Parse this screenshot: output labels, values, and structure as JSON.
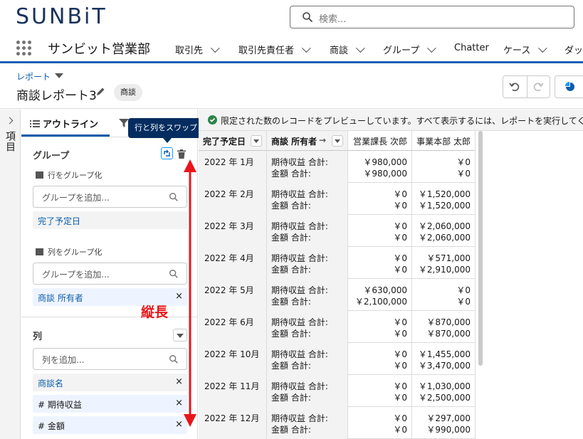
{
  "brand": {
    "logo_text": "SUNBiT"
  },
  "search": {
    "placeholder": "検索..."
  },
  "nav": {
    "app_name": "サンビット営業部",
    "items": [
      {
        "label": "取引先"
      },
      {
        "label": "取引先責任者"
      },
      {
        "label": "商談"
      },
      {
        "label": "グループ"
      },
      {
        "label": "Chatter"
      },
      {
        "label": "ケース"
      },
      {
        "label": "ダッ"
      }
    ]
  },
  "report": {
    "type_label": "レポート",
    "title": "商談レポート3",
    "badge": "商談"
  },
  "left_strip": {
    "label": "項目"
  },
  "outline": {
    "tab_label": "アウトライン",
    "tooltip": "行と列をスワップ",
    "groups_title": "グループ",
    "row_group_label": "行をグループ化",
    "row_group_placeholder": "グループを追加...",
    "row_group_item": "完了予定日",
    "col_group_label": "列をグループ化",
    "col_group_placeholder": "グループを追加...",
    "col_group_item": "商談 所有者",
    "columns_title": "列",
    "columns_placeholder": "列を追加...",
    "columns": [
      {
        "label": "商談名"
      },
      {
        "label": "# 期待収益"
      },
      {
        "label": "# 金額"
      }
    ],
    "remove_glyph": "×"
  },
  "annotation": {
    "text": "縦長",
    "color": "#e8161b"
  },
  "preview": {
    "info": "限定された数のレコードをプレビューしています。すべて表示するには、レポートを実行してくだ",
    "headers": {
      "date": "完了予定日",
      "owner": "商談 所有者",
      "arrow": "→",
      "col1": "営業課長 次郎",
      "col2": "事業本部 太郎"
    },
    "label_expected": "期待収益 合計:",
    "label_amount": "金額 合計:",
    "rows": [
      {
        "date": "2022 年 1月",
        "c1_exp": "￥980,000",
        "c1_amt": "￥980,000",
        "c2_exp": "￥0",
        "c2_amt": "￥0"
      },
      {
        "date": "2022 年 2月",
        "c1_exp": "￥0",
        "c1_amt": "￥0",
        "c2_exp": "￥1,520,000",
        "c2_amt": "￥1,520,000"
      },
      {
        "date": "2022 年 3月",
        "c1_exp": "￥0",
        "c1_amt": "￥0",
        "c2_exp": "￥2,060,000",
        "c2_amt": "￥2,060,000"
      },
      {
        "date": "2022 年 4月",
        "c1_exp": "￥0",
        "c1_amt": "￥0",
        "c2_exp": "￥571,000",
        "c2_amt": "￥2,910,000"
      },
      {
        "date": "2022 年 5月",
        "c1_exp": "￥630,000",
        "c1_amt": "￥2,100,000",
        "c2_exp": "￥0",
        "c2_amt": "￥0"
      },
      {
        "date": "2022 年 6月",
        "c1_exp": "￥0",
        "c1_amt": "￥0",
        "c2_exp": "￥870,000",
        "c2_amt": "￥870,000"
      },
      {
        "date": "2022 年 10月",
        "c1_exp": "￥0",
        "c1_amt": "￥0",
        "c2_exp": "￥1,455,000",
        "c2_amt": "￥3,470,000"
      },
      {
        "date": "2022 年 11月",
        "c1_exp": "￥0",
        "c1_amt": "￥0",
        "c2_exp": "￥1,030,000",
        "c2_amt": "￥2,500,000"
      },
      {
        "date": "2022 年 12月",
        "c1_exp": "￥0",
        "c1_amt": "￥0",
        "c2_exp": "￥297,000",
        "c2_amt": "￥990,000"
      }
    ]
  },
  "colors": {
    "brand": "#18325d",
    "accent": "#0b5cab",
    "nav_bar": "#1b5fb3",
    "tooltip_bg": "#032d60",
    "success": "#2e844a"
  }
}
